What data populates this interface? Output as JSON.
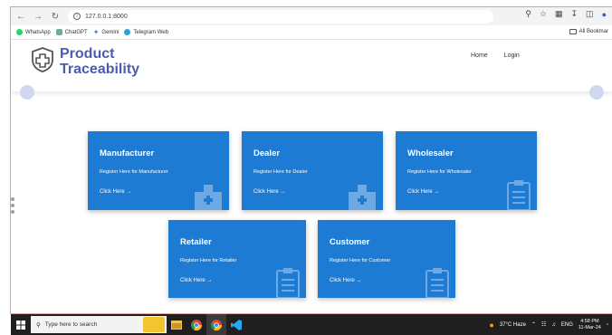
{
  "browser": {
    "url": "127.0.0.1:8000",
    "bookmarks": [
      "WhatsApp",
      "ChatGPT",
      "Gemini",
      "Telegram Web"
    ],
    "all_bookmarks": "All Bookmar"
  },
  "site": {
    "logo_line1": "Product",
    "logo_line2": "Traceability",
    "nav": [
      "Home",
      "Login"
    ]
  },
  "cards": [
    {
      "title": "Manufacturer",
      "desc": "Register Here for Manufacturer",
      "link": "Click Here →",
      "icon": "hospital-icon"
    },
    {
      "title": "Dealer",
      "desc": "Register Here for Dealer",
      "link": "Click Here →",
      "icon": "hospital-icon"
    },
    {
      "title": "Wholesaler",
      "desc": "Register Here for Wholesaler",
      "link": "Click Here →",
      "icon": "clipboard-icon"
    },
    {
      "title": "Retailer",
      "desc": "Register Here for Retailer",
      "link": "Click Here →",
      "icon": "clipboard-icon"
    },
    {
      "title": "Customer",
      "desc": "Register Here for Customer",
      "link": "Click Here →",
      "icon": "clipboard-icon"
    }
  ],
  "taskbar": {
    "search_placeholder": "Type here to search",
    "weather": "37°C  Haze",
    "lang": "ENG",
    "time": "4:58 PM",
    "date": "11-Mar-24"
  },
  "colors": {
    "card": "#1e7bd4",
    "brand": "#4a5bb0"
  }
}
